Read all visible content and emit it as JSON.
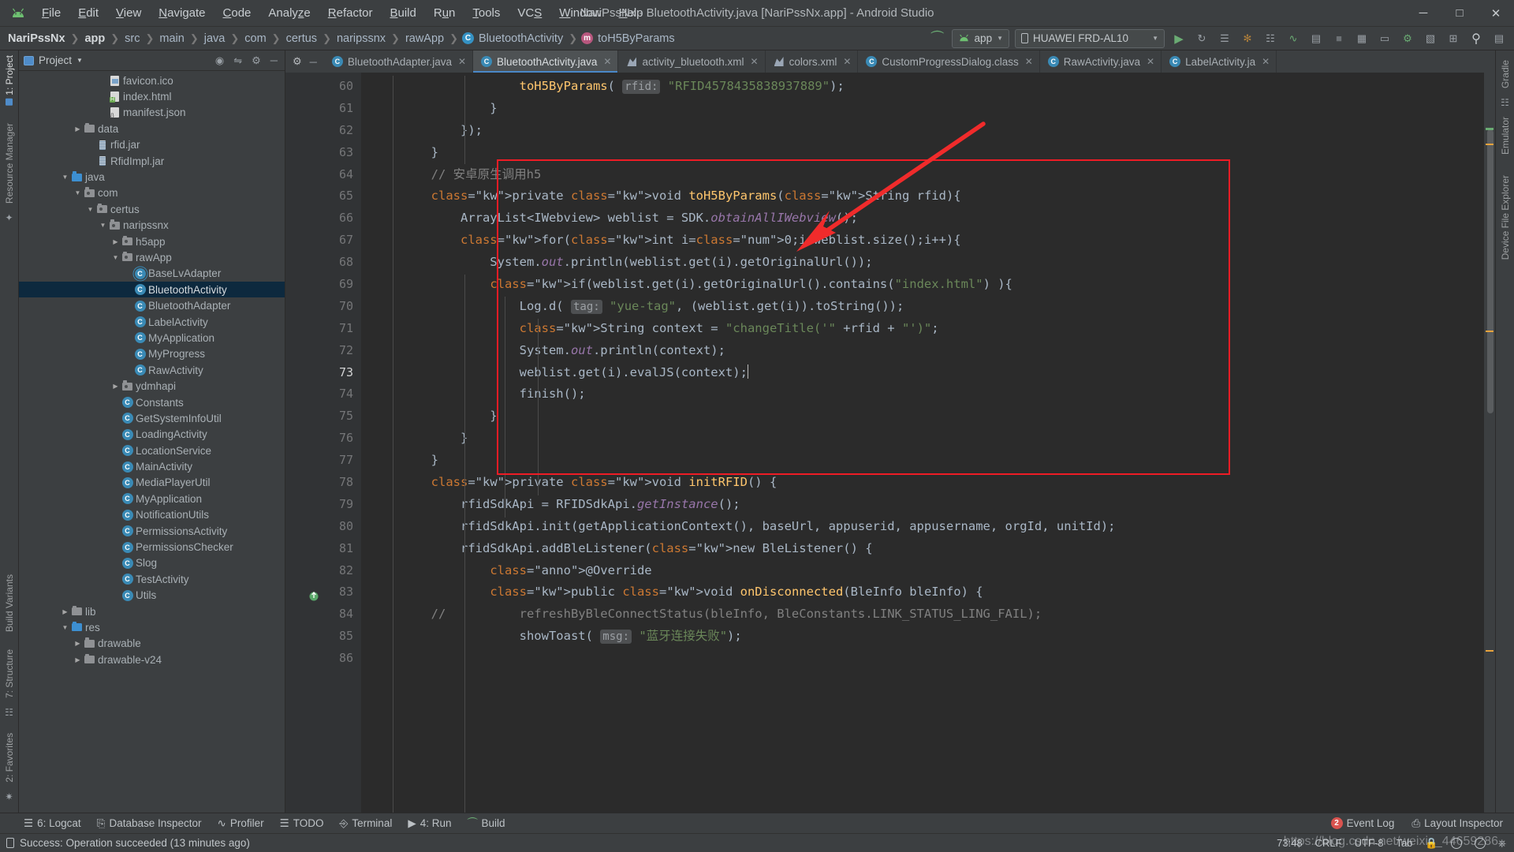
{
  "window": {
    "title": "NariPssNx - BluetoothActivity.java [NariPssNx.app] - Android Studio",
    "logo_icon": "android-icon",
    "minimize_icon": "minimize-icon",
    "maximize_icon": "maximize-icon",
    "close_icon": "close-icon"
  },
  "menu": [
    {
      "label": "File"
    },
    {
      "label": "Edit"
    },
    {
      "label": "View"
    },
    {
      "label": "Navigate"
    },
    {
      "label": "Code"
    },
    {
      "label": "Analyze"
    },
    {
      "label": "Refactor"
    },
    {
      "label": "Build"
    },
    {
      "label": "Run"
    },
    {
      "label": "Tools"
    },
    {
      "label": "VCS"
    },
    {
      "label": "Window"
    },
    {
      "label": "Help"
    }
  ],
  "breadcrumbs": [
    {
      "label": "NariPssNx",
      "bold": true,
      "icon": ""
    },
    {
      "label": "app",
      "bold": true,
      "icon": ""
    },
    {
      "label": "src",
      "bold": false,
      "icon": ""
    },
    {
      "label": "main",
      "bold": false,
      "icon": ""
    },
    {
      "label": "java",
      "bold": false,
      "icon": ""
    },
    {
      "label": "com",
      "bold": false,
      "icon": ""
    },
    {
      "label": "certus",
      "bold": false,
      "icon": ""
    },
    {
      "label": "naripssnx",
      "bold": false,
      "icon": ""
    },
    {
      "label": "rawApp",
      "bold": false,
      "icon": ""
    },
    {
      "label": "BluetoothActivity",
      "bold": false,
      "icon": "class-icon"
    },
    {
      "label": "toH5ByParams",
      "bold": false,
      "icon": "method-icon"
    }
  ],
  "toolbar": {
    "build_icon": "build-hammer-icon",
    "run_config": "app",
    "run_config_icon": "android-icon",
    "device": "HUAWEI FRD-AL10",
    "device_icon": "phone-icon",
    "actions": [
      {
        "name": "run-button",
        "glyph": "▶",
        "color": "#6aab73"
      },
      {
        "name": "rerun-button",
        "glyph": "↻",
        "color": "#8b9196"
      },
      {
        "name": "apply-changes-button",
        "glyph": "☰",
        "color": "#8b9196"
      },
      {
        "name": "debug-button",
        "glyph": "✱",
        "color": "#9aa0a6"
      },
      {
        "name": "attach-debugger-button",
        "glyph": "▣",
        "color": "#8b9196"
      },
      {
        "name": "profile-button",
        "glyph": "∿",
        "color": "#8b9196"
      },
      {
        "name": "run-with-coverage-button",
        "glyph": "▤",
        "color": "#8b9196"
      },
      {
        "name": "stop-button",
        "glyph": "■",
        "color": "#8b9196"
      },
      {
        "name": "sdk-manager-button",
        "glyph": "▦",
        "color": "#8b9196"
      },
      {
        "name": "avd-manager-button",
        "glyph": "▭",
        "color": "#8b9196"
      },
      {
        "name": "device-manager-button",
        "glyph": "⎙",
        "color": "#8b9196"
      },
      {
        "name": "layout-editor-button",
        "glyph": "▧",
        "color": "#8b9196"
      },
      {
        "name": "project-structure-button",
        "glyph": "⊞",
        "color": "#8b9196"
      },
      {
        "name": "search-everywhere-button",
        "glyph": "⌕",
        "color": "#c2c7cb"
      },
      {
        "name": "settings-button",
        "glyph": "▤",
        "color": "#8b9196"
      }
    ]
  },
  "left_strip": [
    {
      "label": "1: Project",
      "active": true
    },
    {
      "label": "Resource Manager",
      "active": false
    },
    {
      "label": "Build Variants",
      "active": false
    },
    {
      "label": "7: Structure",
      "active": false
    },
    {
      "label": "2: Favorites",
      "active": false
    }
  ],
  "right_strip": [
    {
      "label": "Gradle"
    },
    {
      "label": "Emulator"
    },
    {
      "label": "Device File Explorer"
    }
  ],
  "project_panel": {
    "title": "Project",
    "caret_icon": "chevron-down-icon",
    "header_icons": [
      "target-icon",
      "collapse-all-icon",
      "gear-icon",
      "hide-icon"
    ],
    "tree": [
      {
        "depth": 6,
        "label": "favicon.ico",
        "icon": "image-file-icon",
        "arrow": "none"
      },
      {
        "depth": 6,
        "label": "index.html",
        "icon": "html-file-icon",
        "arrow": "none"
      },
      {
        "depth": 6,
        "label": "manifest.json",
        "icon": "json-file-icon",
        "arrow": "none"
      },
      {
        "depth": 4,
        "label": "data",
        "icon": "folder-icon",
        "arrow": "collapsed"
      },
      {
        "depth": 5,
        "label": "rfid.jar",
        "icon": "jar-file-icon",
        "arrow": "none"
      },
      {
        "depth": 5,
        "label": "RfidImpl.jar",
        "icon": "jar-file-icon",
        "arrow": "none"
      },
      {
        "depth": 3,
        "label": "java",
        "icon": "source-folder-icon",
        "arrow": "expanded"
      },
      {
        "depth": 4,
        "label": "com",
        "icon": "package-icon",
        "arrow": "expanded"
      },
      {
        "depth": 5,
        "label": "certus",
        "icon": "package-icon",
        "arrow": "expanded"
      },
      {
        "depth": 6,
        "label": "naripssnx",
        "icon": "package-icon",
        "arrow": "expanded"
      },
      {
        "depth": 7,
        "label": "h5app",
        "icon": "package-icon",
        "arrow": "collapsed"
      },
      {
        "depth": 7,
        "label": "rawApp",
        "icon": "package-icon",
        "arrow": "expanded"
      },
      {
        "depth": 8,
        "label": "BaseLvAdapter",
        "icon": "abstract-class-icon",
        "arrow": "none"
      },
      {
        "depth": 8,
        "label": "BluetoothActivity",
        "icon": "class-icon",
        "arrow": "none",
        "selected": true
      },
      {
        "depth": 8,
        "label": "BluetoothAdapter",
        "icon": "class-icon",
        "arrow": "none"
      },
      {
        "depth": 8,
        "label": "LabelActivity",
        "icon": "class-icon",
        "arrow": "none"
      },
      {
        "depth": 8,
        "label": "MyApplication",
        "icon": "class-icon",
        "arrow": "none"
      },
      {
        "depth": 8,
        "label": "MyProgress",
        "icon": "class-icon",
        "arrow": "none"
      },
      {
        "depth": 8,
        "label": "RawActivity",
        "icon": "class-icon",
        "arrow": "none"
      },
      {
        "depth": 7,
        "label": "ydmhapi",
        "icon": "package-icon",
        "arrow": "collapsed"
      },
      {
        "depth": 7,
        "label": "Constants",
        "icon": "class-icon",
        "arrow": "none"
      },
      {
        "depth": 7,
        "label": "GetSystemInfoUtil",
        "icon": "class-icon",
        "arrow": "none"
      },
      {
        "depth": 7,
        "label": "LoadingActivity",
        "icon": "class-icon",
        "arrow": "none"
      },
      {
        "depth": 7,
        "label": "LocationService",
        "icon": "class-icon",
        "arrow": "none"
      },
      {
        "depth": 7,
        "label": "MainActivity",
        "icon": "class-icon",
        "arrow": "none"
      },
      {
        "depth": 7,
        "label": "MediaPlayerUtil",
        "icon": "class-icon",
        "arrow": "none"
      },
      {
        "depth": 7,
        "label": "MyApplication",
        "icon": "class-icon",
        "arrow": "none"
      },
      {
        "depth": 7,
        "label": "NotificationUtils",
        "icon": "class-icon",
        "arrow": "none"
      },
      {
        "depth": 7,
        "label": "PermissionsActivity",
        "icon": "class-icon",
        "arrow": "none"
      },
      {
        "depth": 7,
        "label": "PermissionsChecker",
        "icon": "class-icon",
        "arrow": "none"
      },
      {
        "depth": 7,
        "label": "Slog",
        "icon": "class-icon",
        "arrow": "none"
      },
      {
        "depth": 7,
        "label": "TestActivity",
        "icon": "class-icon",
        "arrow": "none"
      },
      {
        "depth": 7,
        "label": "Utils",
        "icon": "class-icon",
        "arrow": "none"
      },
      {
        "depth": 3,
        "label": "lib",
        "icon": "folder-icon",
        "arrow": "collapsed"
      },
      {
        "depth": 3,
        "label": "res",
        "icon": "source-folder-icon",
        "arrow": "expanded"
      },
      {
        "depth": 4,
        "label": "drawable",
        "icon": "folder-icon",
        "arrow": "collapsed"
      },
      {
        "depth": 4,
        "label": "drawable-v24",
        "icon": "folder-icon",
        "arrow": "collapsed"
      }
    ]
  },
  "editor_tabs": [
    {
      "label": "BluetoothAdapter.java",
      "icon": "java-class-icon",
      "active": false
    },
    {
      "label": "BluetoothActivity.java",
      "icon": "java-class-icon",
      "active": true
    },
    {
      "label": "activity_bluetooth.xml",
      "icon": "android-xml-icon",
      "active": false
    },
    {
      "label": "colors.xml",
      "icon": "android-xml-icon",
      "active": false
    },
    {
      "label": "CustomProgressDialog.class",
      "icon": "java-class-icon",
      "active": false
    },
    {
      "label": "RawActivity.java",
      "icon": "java-class-icon",
      "active": false
    },
    {
      "label": "LabelActivity.ja",
      "icon": "java-class-icon",
      "active": false
    }
  ],
  "code": {
    "first_line": 60,
    "current_line": 73,
    "lines": [
      {
        "n": 60,
        "fold": "none",
        "text": "                    toH5ByParams( rfid: \"RFID4578435838937889\");"
      },
      {
        "n": 61,
        "fold": "end",
        "text": "                }"
      },
      {
        "n": 62,
        "fold": "end",
        "text": "            });"
      },
      {
        "n": 63,
        "fold": "end",
        "text": "        }"
      },
      {
        "n": 64,
        "fold": "none",
        "text": "        // 安卓原生调用h5"
      },
      {
        "n": 65,
        "fold": "start",
        "text": "        private void toH5ByParams(String rfid){"
      },
      {
        "n": 66,
        "fold": "none",
        "text": "            ArrayList<IWebview> weblist = SDK.obtainAllIWebview();"
      },
      {
        "n": 67,
        "fold": "start",
        "text": "            for(int i=0;i<weblist.size();i++){"
      },
      {
        "n": 68,
        "fold": "none",
        "text": "                System.out.println(weblist.get(i).getOriginalUrl());"
      },
      {
        "n": 69,
        "fold": "start",
        "text": "                if(weblist.get(i).getOriginalUrl().contains(\"index.html\") ){"
      },
      {
        "n": 70,
        "fold": "none",
        "text": "                    Log.d( tag: \"yue-tag\", (weblist.get(i)).toString());"
      },
      {
        "n": 71,
        "fold": "none",
        "text": "                    String context = \"changeTitle('\" +rfid + \"')\";"
      },
      {
        "n": 72,
        "fold": "none",
        "text": "                    System.out.println(context);"
      },
      {
        "n": 73,
        "fold": "none",
        "text": "                    weblist.get(i).evalJS(context);"
      },
      {
        "n": 74,
        "fold": "none",
        "text": "                    finish();"
      },
      {
        "n": 75,
        "fold": "end",
        "text": "                }"
      },
      {
        "n": 76,
        "fold": "end",
        "text": "            }"
      },
      {
        "n": 77,
        "fold": "end",
        "text": "        }"
      },
      {
        "n": 78,
        "fold": "none",
        "text": "        private void initRFID() {"
      },
      {
        "n": 79,
        "fold": "none",
        "text": "            rfidSdkApi = RFIDSdkApi.getInstance();"
      },
      {
        "n": 80,
        "fold": "none",
        "text": "            rfidSdkApi.init(getApplicationContext(), baseUrl, appuserid, appusername, orgId, unitId);"
      },
      {
        "n": 81,
        "fold": "start",
        "text": "            rfidSdkApi.addBleListener(new BleListener() {"
      },
      {
        "n": 82,
        "fold": "none",
        "text": "                @Override"
      },
      {
        "n": 83,
        "fold": "start",
        "text": "                public void onDisconnected(BleInfo bleInfo) {"
      },
      {
        "n": 84,
        "fold": "none",
        "text": "        //          refreshByBleConnectStatus(bleInfo, BleConstants.LINK_STATUS_LING_FAIL);"
      },
      {
        "n": 85,
        "fold": "none",
        "text": "                    showToast( msg: \"蓝牙连接失败\");"
      },
      {
        "n": 86,
        "fold": "none",
        "text": ""
      }
    ]
  },
  "annotation": {
    "box_color": "#ee1c25",
    "arrow_color": "#f02b2b",
    "description": "red-highlight-box-around-toH5ByParams-method"
  },
  "bottom_tabs": [
    {
      "label": "6: Logcat",
      "icon": "logcat-icon",
      "mnemonic": "6"
    },
    {
      "label": "Database Inspector",
      "icon": "database-icon",
      "mnemonic": ""
    },
    {
      "label": "Profiler",
      "icon": "profiler-icon",
      "mnemonic": ""
    },
    {
      "label": "TODO",
      "icon": "todo-icon",
      "mnemonic": ""
    },
    {
      "label": "Terminal",
      "icon": "terminal-icon",
      "mnemonic": ""
    },
    {
      "label": "4: Run",
      "icon": "run-icon",
      "mnemonic": "4"
    },
    {
      "label": "Build",
      "icon": "build-icon",
      "mnemonic": ""
    }
  ],
  "bottom_right": [
    {
      "label": "Event Log",
      "icon": "event-log-icon",
      "badge": "2"
    },
    {
      "label": "Layout Inspector",
      "icon": "layout-inspector-icon",
      "badge": ""
    }
  ],
  "status": {
    "icon": "device-icon",
    "message": "Success: Operation succeeded (13 minutes ago)",
    "caret_position": "73:48",
    "line_separator": "CRLF",
    "encoding": "UTF-8",
    "indent": "Tab",
    "lock_icon": "lock-icon",
    "happy_icon": "happy-face-icon",
    "sad_icon": "sad-face-icon",
    "memory_icon": "memory-indicator-icon"
  },
  "watermark": "https://blog.csdn.net/weixin_44659286",
  "colors": {
    "accent_blue": "#4a88c7",
    "selection": "#0d293e",
    "editor_bg": "#2b2b2b",
    "panel_bg": "#3c3f41",
    "gutter_bg": "#313335",
    "annotation_red": "#ee1c25"
  }
}
